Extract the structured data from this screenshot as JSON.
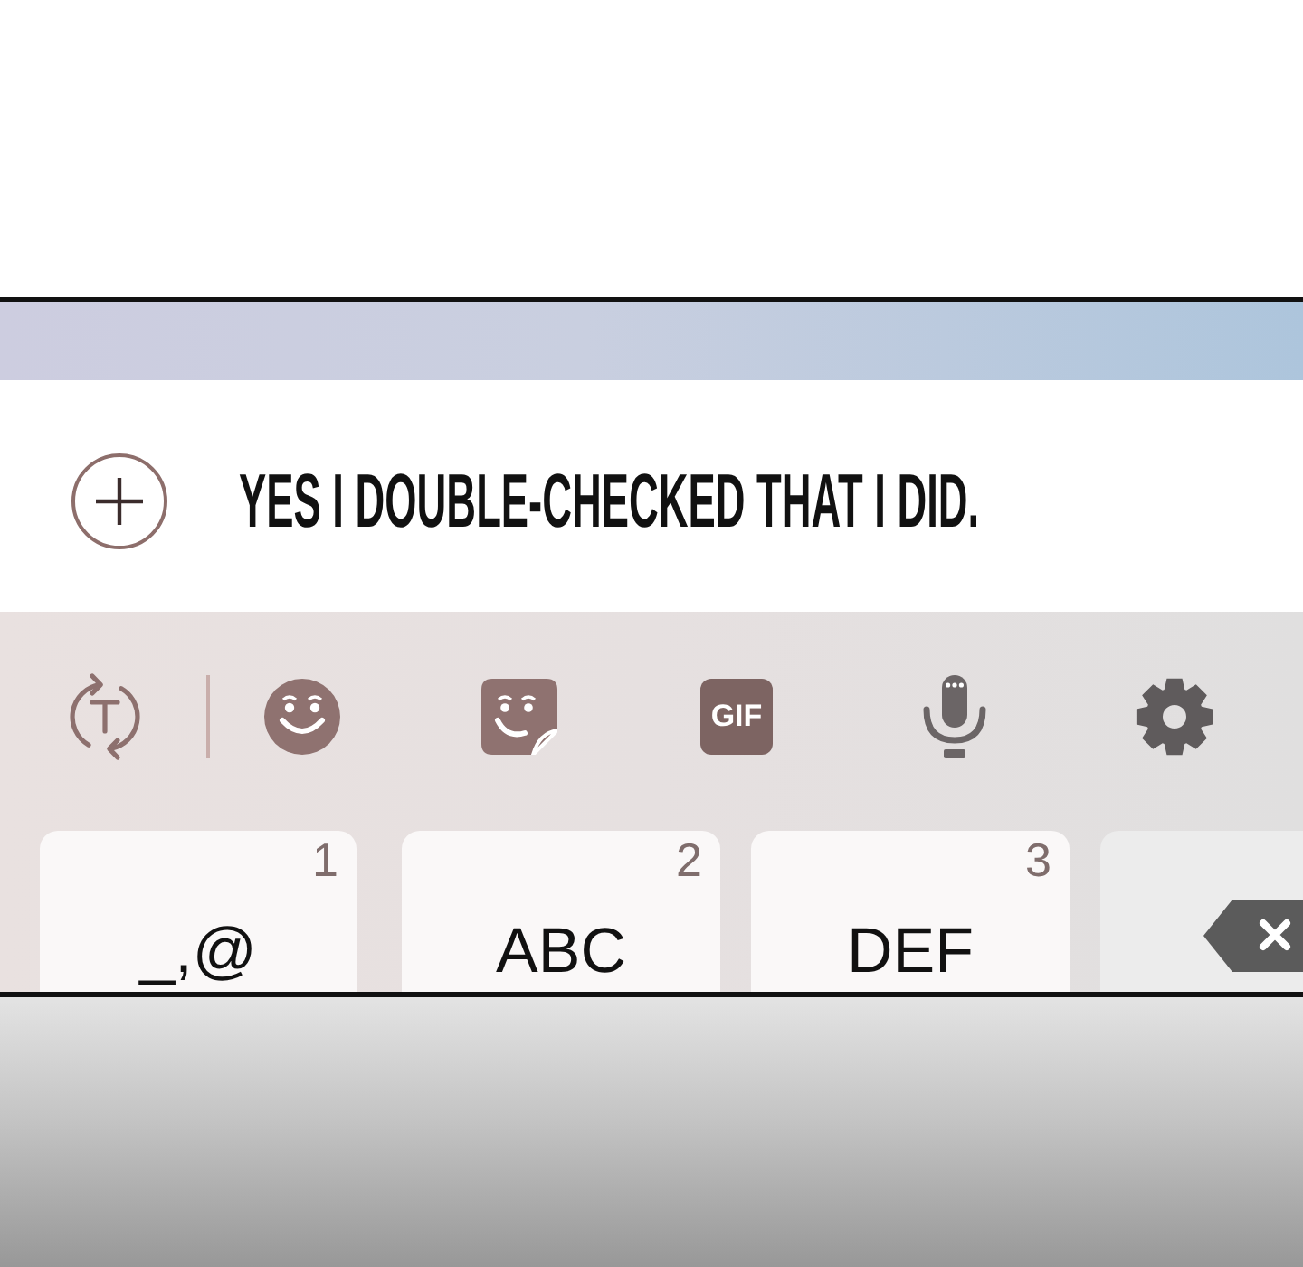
{
  "message_bar": {
    "text": "YES I DOUBLE-CHECKED THAT I DID."
  },
  "keyboard": {
    "toolbar": {
      "gif_label": "GIF"
    },
    "keys": [
      {
        "kind": "text",
        "number": "1",
        "label": "_,@"
      },
      {
        "kind": "text",
        "number": "2",
        "label": "ABC"
      },
      {
        "kind": "text",
        "number": "3",
        "label": "DEF"
      },
      {
        "kind": "backspace"
      }
    ]
  }
}
